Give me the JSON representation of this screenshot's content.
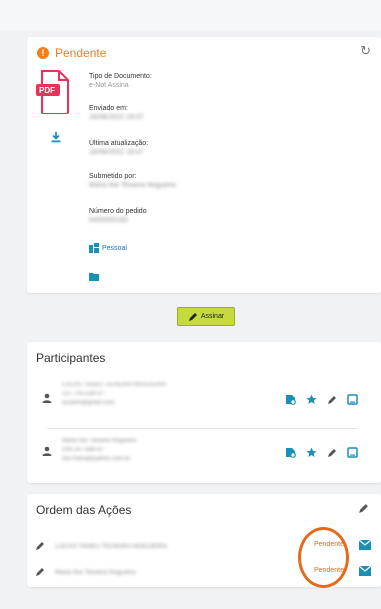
{
  "document": {
    "status": "Pendente",
    "icons": {
      "status": "alert-icon",
      "refresh": "refresh-icon",
      "file": "pdf-file-icon",
      "download": "download-icon"
    },
    "pdf_badge": "PDF",
    "doc_type_label": "Tipo de Documento:",
    "doc_type_value": "e-Not Assina",
    "sent_label": "Enviado em:",
    "sent_value": "16/06/2022 19:07",
    "updated_label": "Última atualização:",
    "updated_value": "16/06/2022 19:07",
    "submitted_label": "Submetido por:",
    "submitted_value": "Maria Ilse Teixeira Nogueira",
    "order_label": "Número do pedido",
    "order_value": "6400000183",
    "folder_label": "Pessoal"
  },
  "sign_button": "Assinar",
  "participants": {
    "title": "Participantes",
    "list": [
      {
        "name": "LUCAS TADEU TEIXEIRA NOGUEIRA",
        "doc": "137.703.528-37",
        "email": "lucastn@gmail.com"
      },
      {
        "name": "Maria Ilse Teixeira Nogueira",
        "doc": "209.247.896-87",
        "email": "ilse.maria@yahoo.com.br"
      }
    ],
    "icons": [
      "seal-icon",
      "star-icon",
      "pen-icon",
      "tablet-icon"
    ]
  },
  "order": {
    "title": "Ordem das Ações",
    "rows": [
      {
        "name": "LUCAS TADEU TEIXEIRA NOGUEIRA",
        "status": "Pendente"
      },
      {
        "name": "Maria Ilse Teixeira Nogueira",
        "status": "Pendente"
      }
    ]
  },
  "colors": {
    "accent": "#1a8fb8",
    "pending": "#f07f1c",
    "button": "#c6d93d",
    "pdf": "#e63359"
  }
}
